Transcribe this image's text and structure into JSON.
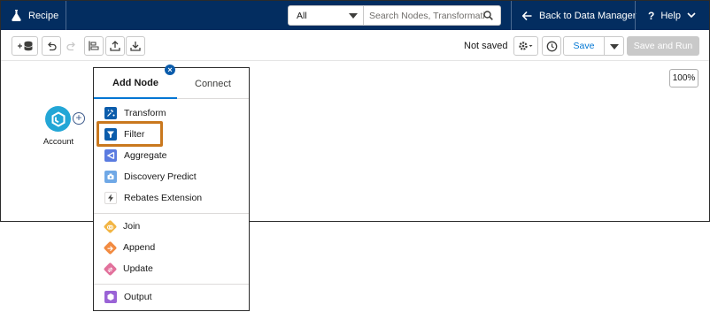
{
  "app": {
    "title": "Recipe"
  },
  "search": {
    "scope": "All",
    "placeholder": "Search Nodes, Transformations"
  },
  "header": {
    "back_label": "Back to Data Manager",
    "help_label": "Help"
  },
  "toolbar": {
    "status": "Not saved",
    "save_label": "Save",
    "save_and_run_label": "Save and Run"
  },
  "canvas": {
    "zoom": "100%",
    "nodes": [
      {
        "label": "Account"
      }
    ]
  },
  "popover": {
    "tabs": [
      {
        "label": "Add Node",
        "active": true
      },
      {
        "label": "Connect",
        "active": false
      }
    ],
    "groups": [
      [
        {
          "label": "Transform",
          "icon": "transform-icon",
          "color": "#0b5cab"
        },
        {
          "label": "Filter",
          "icon": "filter-icon",
          "color": "#0b5cab",
          "highlighted": true
        },
        {
          "label": "Aggregate",
          "icon": "aggregate-icon",
          "color": "#5a7be0"
        },
        {
          "label": "Discovery Predict",
          "icon": "discovery-predict-icon",
          "color": "#6fa8e6"
        },
        {
          "label": "Rebates Extension",
          "icon": "lightning-icon",
          "color": "#3e3e3c"
        }
      ],
      [
        {
          "label": "Join",
          "icon": "join-icon",
          "color": "#f2b544"
        },
        {
          "label": "Append",
          "icon": "append-icon",
          "color": "#f28b41"
        },
        {
          "label": "Update",
          "icon": "update-icon",
          "color": "#e2719c"
        }
      ],
      [
        {
          "label": "Output",
          "icon": "output-icon",
          "color": "#9a63d6"
        }
      ]
    ]
  },
  "colors": {
    "header_bg": "#032d60",
    "accent": "#0176d3",
    "highlight": "#c9781e"
  }
}
